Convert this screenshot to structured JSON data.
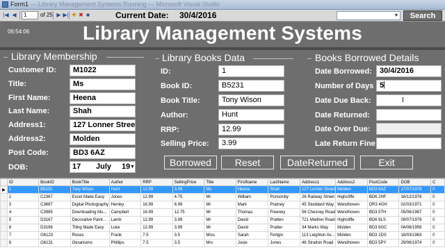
{
  "window": {
    "title": "Form1",
    "title_faded": " — Library Management Systems Running — Microsoft Visual Studio"
  },
  "toolbar": {
    "position": "1",
    "of_count": "of 25",
    "current_date_label": "Current Date:",
    "current_date_value": "30/4/2016",
    "search_label": "Search",
    "search_value": ""
  },
  "clock": "06:54:06",
  "title": "Library Management Systems",
  "membership": {
    "heading": "Library Membership",
    "fields": [
      {
        "label": "Customer ID:",
        "value": "M1022"
      },
      {
        "label": "Title:",
        "value": "Ms"
      },
      {
        "label": "First Name:",
        "value": "Heena"
      },
      {
        "label": "Last Name:",
        "value": "Shah"
      },
      {
        "label": "Address1:",
        "value": "127 Lonner Street"
      },
      {
        "label": "Address2:",
        "value": "Molden"
      },
      {
        "label": "Post Code:",
        "value": "BD3 6AZ"
      }
    ],
    "dob": {
      "label": "DOB:",
      "day": "17",
      "month": "July",
      "year": "19"
    }
  },
  "books": {
    "heading": "Library Books Data",
    "fields": [
      {
        "label": "ID:",
        "value": "1"
      },
      {
        "label": "Book ID:",
        "value": "B5231"
      },
      {
        "label": "Book Title:",
        "value": "Tony Wison"
      },
      {
        "label": "Author:",
        "value": "Hunt"
      },
      {
        "label": "RRP:",
        "value": "12.99"
      },
      {
        "label": "Selling Price:",
        "value": "3.99"
      }
    ]
  },
  "borrowed": {
    "heading": "Books Borrowed Details",
    "fields": [
      {
        "label": "Date Borrowed:",
        "value": "30/4/2016"
      },
      {
        "label": "Number of Days",
        "value": "5"
      },
      {
        "label": "Date Due Back:",
        "value": ""
      },
      {
        "label": "Date Returned:",
        "value": ""
      },
      {
        "label": "Date Over Due:",
        "value": ""
      },
      {
        "label": "Late Return Fine:",
        "value": ""
      }
    ]
  },
  "actions": {
    "borrowed": "Borrowed",
    "reset": "Reset",
    "date_returned": "DateReturned",
    "exit": "Exit"
  },
  "table": {
    "columns": [
      "ID",
      "BookID",
      "BookTitle",
      "Author",
      "RRP",
      "SellingPrice",
      "Title",
      "FirstName",
      "LastName",
      "Address1",
      "Address2",
      "PostCode",
      "DOB",
      "C"
    ],
    "rows": [
      [
        "1",
        "B5231",
        "Tony Wison",
        "Hunt",
        "12.99",
        "3.99",
        "Ms",
        "Heena",
        "Shah",
        "127 Lonner Street",
        "Molden",
        "BD3 6AZ",
        "17/07/1979",
        "0"
      ],
      [
        "2",
        "C2367",
        "Excel Made Easy",
        "Jones",
        "12.99",
        "4.75",
        "Mr",
        "William",
        "Ponsonby",
        "26 Railway Street",
        "Highcliffe",
        "BD6 2HF",
        "16/12/1978",
        "0"
      ],
      [
        "3",
        "C3687",
        "Digital Photography",
        "Henley",
        "16.99",
        "6.99",
        "Mr",
        "Mark",
        "Pratney",
        "45 Stoddard Way",
        "Wendhoven",
        "DR3 4GH",
        "02/03/1971",
        "0"
      ],
      [
        "4",
        "C3985",
        "Downloading Mu...",
        "Campbell",
        "16.99",
        "12.75",
        "Mr",
        "Thomas",
        "Freeney",
        "56 Chesney Road",
        "Wendhoven",
        "BD3 5TH",
        "05/06/1967",
        "0"
      ],
      [
        "5",
        "D3167",
        "Decorative Paint...",
        "Lamb",
        "12.99",
        "3.99",
        "Mr",
        "David",
        "Pratten",
        "721 Meither Road",
        "Highcliffe",
        "BD6 8LS",
        "09/07/1978",
        "0"
      ],
      [
        "6",
        "D3196",
        "Tiling Made Easy",
        "Luke",
        "12.99",
        "3.99",
        "Mr",
        "David",
        "Pratter",
        "34 Marks Way",
        "Molden",
        "BD3 6GC",
        "04/06/1958",
        "0"
      ],
      [
        "7",
        "G6123",
        "Roses",
        "Frank",
        "7.5",
        "3.5",
        "Miss",
        "Sarah",
        "Fertgin",
        "113 Leighton Av...",
        "Molden",
        "BD3 2DS",
        "18/03/1963",
        "0"
      ],
      [
        "8",
        "G6131",
        "Geraniums",
        "Phillips",
        "7.5",
        "3.5",
        "Mrs",
        "Josie",
        "Jones",
        "46 Stratton Road",
        "Wendhoven",
        "BD3 5PY",
        "29/06/1974",
        "0"
      ]
    ]
  },
  "colors": {
    "background": "#6e6e6e",
    "selection": "#3399ff",
    "field": "#ffffff"
  }
}
